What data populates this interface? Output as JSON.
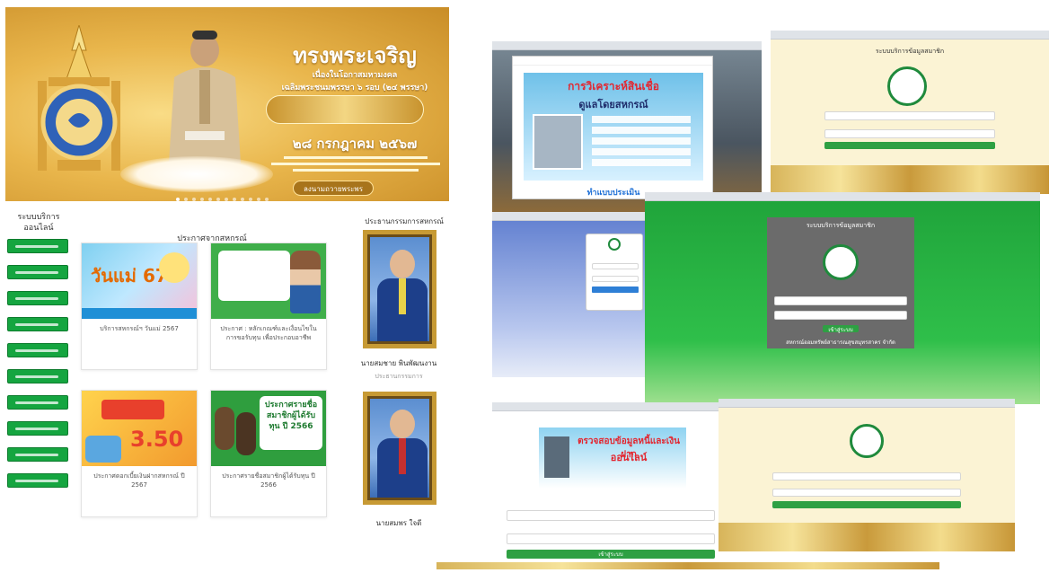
{
  "banner": {
    "title": "ทรงพระเจริญ",
    "subtitle": "เนื่องในโอกาสมหามงคล",
    "subtitle2": "เฉลิมพระชนมพรรษา ๖ รอบ (๒๔ พรรษา)",
    "date": "๒๘ กรกฎาคม ๒๕๖๗",
    "button": "ลงนามถวายพระพร"
  },
  "sidebar": {
    "title_line1": "ระบบบริการ",
    "title_line2": "ออนไลน์",
    "items": [
      "",
      "",
      "",
      "",
      "",
      "",
      "",
      "",
      "",
      "",
      "",
      ""
    ]
  },
  "news": {
    "title": "ประกาศจากสหกรณ์",
    "cards": [
      {
        "image_text": "วันแม่ 67",
        "title": "บริการสหกรณ์ฯ วันแม่ 2567",
        "date": ""
      },
      {
        "image_text": "",
        "title": "ประกาศ : หลักเกณฑ์และเงื่อนไขในการขอรับทุน เพื่อประกอบอาชีพ",
        "date": ""
      },
      {
        "image_text": "3.50",
        "title": "ประกาศดอกเบี้ยเงินฝากสหกรณ์ ปี 2567",
        "date": ""
      },
      {
        "image_text": "ประกาศรายชื่อ สมาชิกผู้ได้รับทุน ปี 2566",
        "title": "ประกาศรายชื่อสมาชิกผู้ได้รับทุน ปี 2566",
        "date": ""
      }
    ]
  },
  "execs": {
    "title": "ประธานกรรมการสหกรณ์",
    "people": [
      {
        "name": "นายสมชาย พินพัฒนงาน",
        "role": "ประธานกรรมการ"
      },
      {
        "name": "นายสมพร ใจดี",
        "role": ""
      }
    ]
  },
  "collage": {
    "popup_title": "การวิเคราะห์สินเชื่อ",
    "popup_sub": "ดูแลโดยสหกรณ์",
    "popup_link": "ทำแบบประเมิน",
    "login_title": "ระบบบริการข้อมูลสมาชิก",
    "member_title": "ระบบบริการข้อมูลสมาชิก",
    "member_sub": "สหกรณ์ออมทรัพย์สาธารณสุขสมุทรสาคร จำกัด",
    "member_button": "เข้าสู่ระบบ",
    "loan_title": "ตรวจสอบข้อมูลหนี้และเงินฝาก",
    "loan_sub": "ออนไลน์",
    "login_button": "เข้าสู่ระบบ"
  },
  "colors": {
    "brand_green": "#15a540",
    "gold": "#e0aa45",
    "login_green": "#2ea043"
  },
  "footer": {
    "pager": ""
  }
}
